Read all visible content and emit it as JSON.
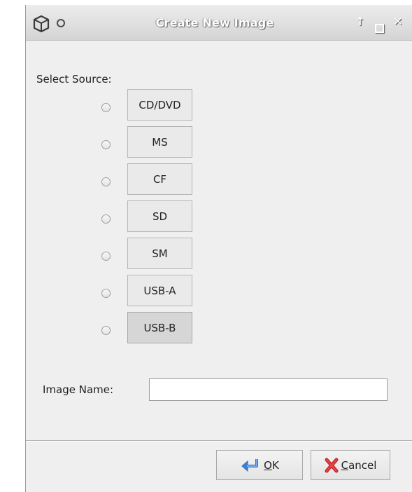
{
  "window": {
    "title": "Create New Image"
  },
  "titlebar_controls": {
    "up": "↑",
    "close": "✕"
  },
  "source": {
    "label": "Select Source:",
    "options": [
      "CD/DVD",
      "MS",
      "CF",
      "SD",
      "SM",
      "USB-A",
      "USB-B"
    ]
  },
  "image_name": {
    "label": "Image Name:",
    "value": "",
    "placeholder": ""
  },
  "buttons": {
    "ok_mnemonic": "O",
    "ok_rest": "K",
    "cancel_mnemonic": "C",
    "cancel_rest": "ancel"
  },
  "colors": {
    "titlebar": "#dcdcdc",
    "window_bg": "#efefef",
    "ok_icon": "#3b7fd6",
    "cancel_icon": "#d42a2a"
  },
  "icons": {
    "app": "cube-icon",
    "menu": "circle-icon",
    "up": "arrow-up-icon",
    "maximize": "maximize-icon",
    "close": "close-icon",
    "ok": "return-arrow-icon",
    "cancel": "cross-icon"
  }
}
